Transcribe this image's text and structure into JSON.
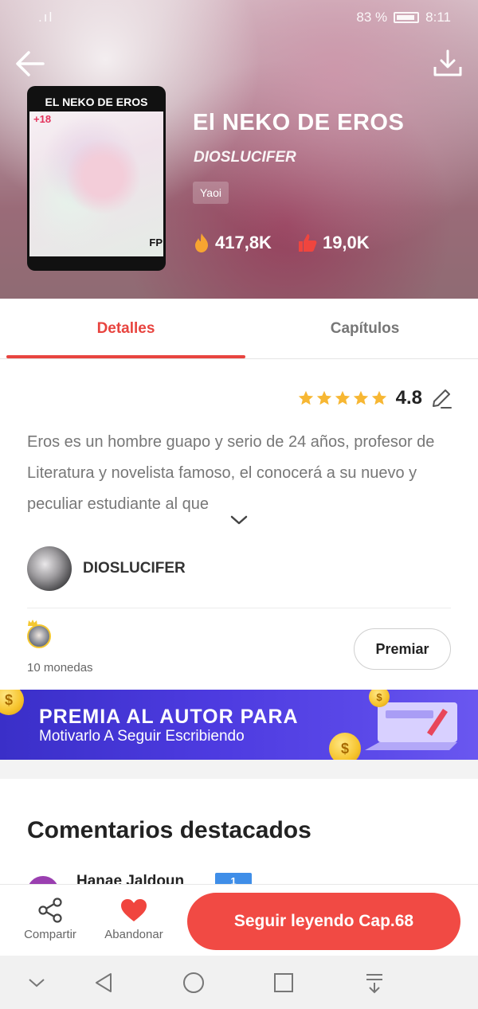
{
  "status_bar": {
    "signal": ".ıl",
    "battery_text": "83 %",
    "time": "8:11"
  },
  "book": {
    "title": "El NEKO DE EROS",
    "author": "DIOSLUCIFER",
    "genre": "Yaoi",
    "views": "417,8K",
    "likes": "19,0K",
    "cover": {
      "title_text": "EL NEKO DE EROS",
      "age_tag": "+18",
      "corner_mark": "FP"
    }
  },
  "tabs": [
    {
      "label": "Detalles",
      "active": true
    },
    {
      "label": "Capítulos",
      "active": false
    }
  ],
  "rating": {
    "value": "4.8",
    "stars": 5
  },
  "description": "Eros es un hombre guapo y serio de 24 años, profesor de Literatura y novelista famoso, el conocerá a su nuevo y peculiar estudiante al que",
  "author_row": {
    "name": "DIOSLUCIFER"
  },
  "reward": {
    "coins_text": "10 monedas",
    "button_label": "Premiar"
  },
  "banner": {
    "line1": "PREMIA AL AUTOR PARA",
    "line2": "Motivarlo A Seguir Escribiendo"
  },
  "comments": {
    "title": "Comentarios destacados",
    "first_user": "Hanae Jaldoun",
    "first_badge": "1"
  },
  "actions": {
    "share_label": "Compartir",
    "abandon_label": "Abandonar",
    "continue_label": "Seguir leyendo Cap.68"
  },
  "colors": {
    "accent": "#e8443f",
    "button_red": "#f14a44",
    "banner_blue": "#4d3be0",
    "star": "#f7b733"
  },
  "icons": [
    "back-arrow-icon",
    "download-icon",
    "fire-icon",
    "thumbs-up-icon",
    "star-icon",
    "edit-pencil-icon",
    "chevron-down-icon",
    "share-icon",
    "heart-icon",
    "crown-icon"
  ]
}
